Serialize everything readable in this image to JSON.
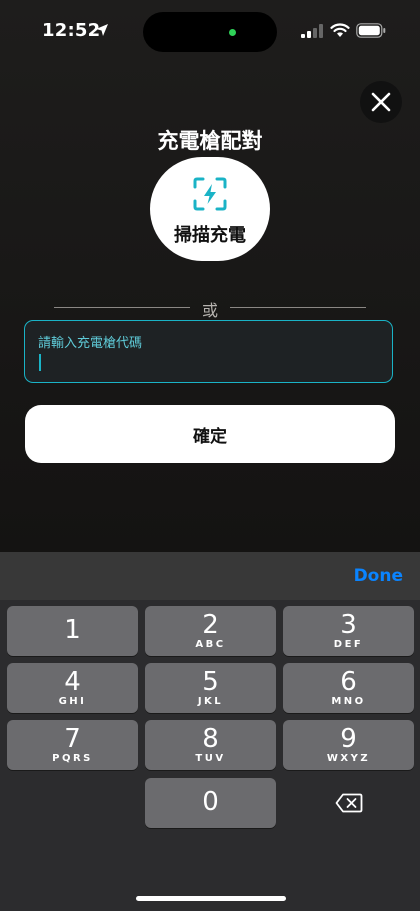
{
  "status_bar": {
    "time": "12:52"
  },
  "pairing": {
    "title": "充電槍配對",
    "scan_label": "掃描充電",
    "or_text": "或",
    "input_placeholder": "請輸入充電槍代碼",
    "input_value": "",
    "confirm_label": "確定"
  },
  "keyboard": {
    "done_label": "Done",
    "keys": [
      {
        "digit": "1",
        "letters": ""
      },
      {
        "digit": "2",
        "letters": "ABC"
      },
      {
        "digit": "3",
        "letters": "DEF"
      },
      {
        "digit": "4",
        "letters": "GHI"
      },
      {
        "digit": "5",
        "letters": "JKL"
      },
      {
        "digit": "6",
        "letters": "MNO"
      },
      {
        "digit": "7",
        "letters": "PQRS"
      },
      {
        "digit": "8",
        "letters": "TUV"
      },
      {
        "digit": "9",
        "letters": "WXYZ"
      },
      {
        "digit": "0",
        "letters": ""
      }
    ]
  },
  "colors": {
    "accent": "#1ab3c6",
    "keyboard_link": "#0a84ff",
    "camera_dot": "#2fd158"
  },
  "icons": [
    "location-arrow-icon",
    "signal-icon",
    "wifi-icon",
    "battery-icon",
    "close-icon",
    "scan-bolt-icon",
    "delete-backspace-icon"
  ]
}
